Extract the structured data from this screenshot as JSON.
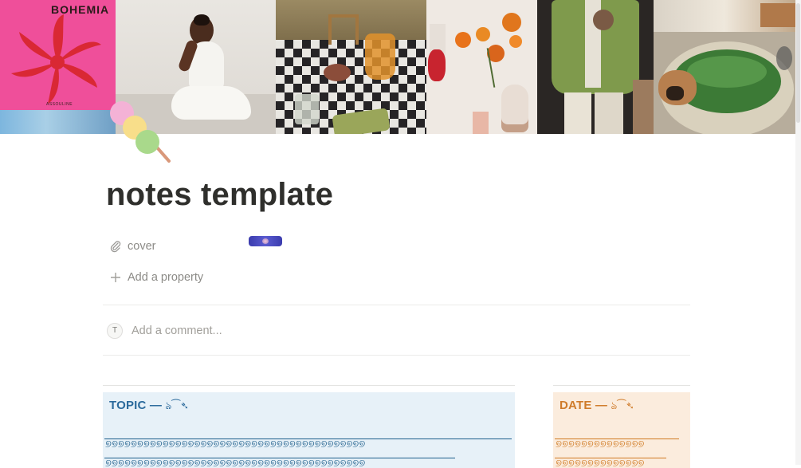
{
  "cover": {
    "tiles": [
      {
        "name": "cover-image-bohemia-book",
        "caption": "BOHEMIA",
        "subcaption": "ASSOULINE"
      },
      {
        "name": "cover-image-woman-seated"
      },
      {
        "name": "cover-image-picnic"
      },
      {
        "name": "cover-image-orange-flowers"
      },
      {
        "name": "cover-image-green-jacket"
      },
      {
        "name": "cover-image-dog-in-planter"
      }
    ]
  },
  "page": {
    "icon": "dango-icon",
    "title": "notes template"
  },
  "properties": [
    {
      "icon": "paperclip-icon",
      "label": "cover"
    }
  ],
  "add_property": {
    "icon": "plus-icon",
    "label": "Add a property"
  },
  "comment": {
    "avatar_initial": "T",
    "placeholder": "Add a comment..."
  },
  "callouts": {
    "topic": {
      "label": "TOPIC —",
      "deco": "ঌ⁀➴",
      "wave": "୭୭୭୭୭୭୭୭୭୭୭୭୭୭୭୭୭୭୭୭୭୭୭୭୭୭୭୭୭୭୭୭୭୭୭୭୭୭୭୭୭"
    },
    "date": {
      "label": "DATE —",
      "deco": "ঌ⁀➴",
      "wave": "୭୭୭୭୭୭୭୭୭୭୭୭୭୭"
    }
  },
  "colors": {
    "topic_bg": "#e7f1f8",
    "topic_accent": "#2b6a9c",
    "date_bg": "#fbecdd",
    "date_accent": "#cf7b2a"
  }
}
